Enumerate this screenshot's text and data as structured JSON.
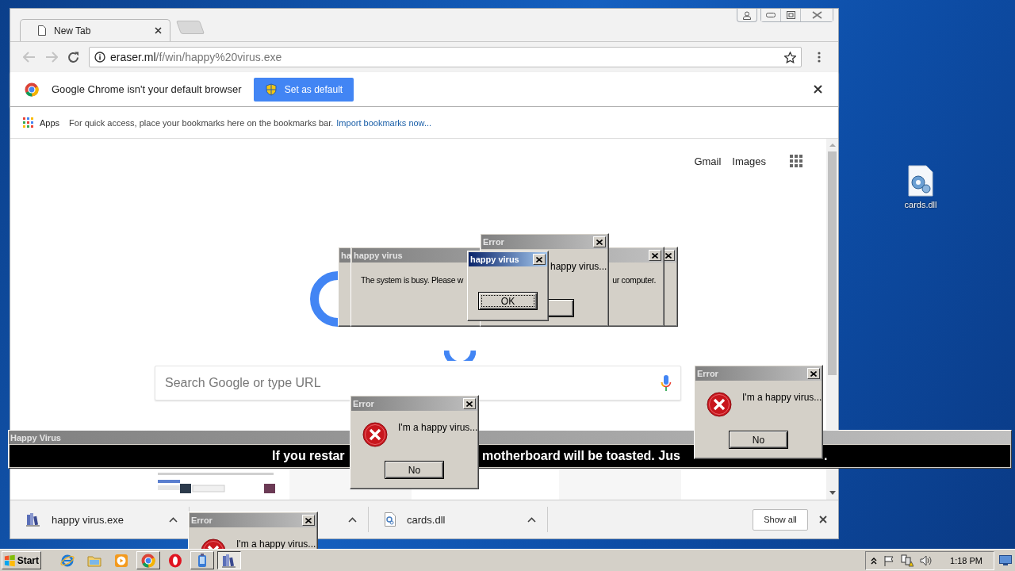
{
  "desktop": {
    "icons": [
      {
        "label": "cards.dll"
      }
    ]
  },
  "browser": {
    "tabs": [
      {
        "label": "New Tab",
        "selected": true
      }
    ],
    "address": {
      "host": "eraser.ml",
      "path": "/f/win/happy%20virus.exe"
    },
    "infobar": {
      "message": "Google Chrome isn't your default browser",
      "button": "Set as default"
    },
    "bookmarks_bar": {
      "apps": "Apps",
      "hint": "For quick access, place your bookmarks here on the bookmarks bar.",
      "link": "Import bookmarks now..."
    },
    "new_tab_page": {
      "links": [
        "Gmail",
        "Images"
      ],
      "search_placeholder": "Search Google or type URL"
    },
    "downloads": [
      {
        "kind": "exe",
        "name": "happy virus.exe"
      },
      {
        "kind": "covered"
      },
      {
        "kind": "dll",
        "name": "cards.dll"
      }
    ],
    "show_all": "Show all"
  },
  "dialogs": [
    {
      "kind": "frame",
      "title": "ha",
      "active": false
    },
    {
      "kind": "busy",
      "title": "happy virus",
      "active": false,
      "message_parts": [
        "The system is busy. Please w",
        "ur computer."
      ]
    },
    {
      "kind": "error_covered",
      "title": "Error",
      "active": false,
      "message": "happy virus..."
    },
    {
      "kind": "prompt",
      "title": "happy virus",
      "active": true,
      "button": "OK"
    }
  ],
  "banner": {
    "title": "Happy Virus",
    "message_parts": [
      "If you restar",
      "motherboard will be toasted. Jus",
      "."
    ]
  },
  "top_dialogs": [
    {
      "kind": "error",
      "title": "Error",
      "active": false,
      "message": "I'm a happy virus...",
      "button": "No"
    },
    {
      "kind": "error",
      "title": "Error",
      "active": false,
      "message": "I'm a happy virus...",
      "button": "No"
    },
    {
      "kind": "error",
      "title": "Error",
      "active": false,
      "message": "I'm a happy virus..."
    }
  ],
  "taskbar": {
    "start": "Start",
    "apps": [
      {
        "kind": "ie",
        "running": false,
        "selected": false
      },
      {
        "kind": "folder",
        "running": false,
        "selected": false
      },
      {
        "kind": "media",
        "running": false,
        "selected": false
      },
      {
        "kind": "chrome",
        "running": true,
        "selected": false
      },
      {
        "kind": "opera",
        "running": false,
        "selected": false
      },
      {
        "kind": "app",
        "running": true,
        "selected": false
      },
      {
        "kind": "virus",
        "running": true,
        "selected": true
      }
    ],
    "clock": "1:18 PM"
  }
}
